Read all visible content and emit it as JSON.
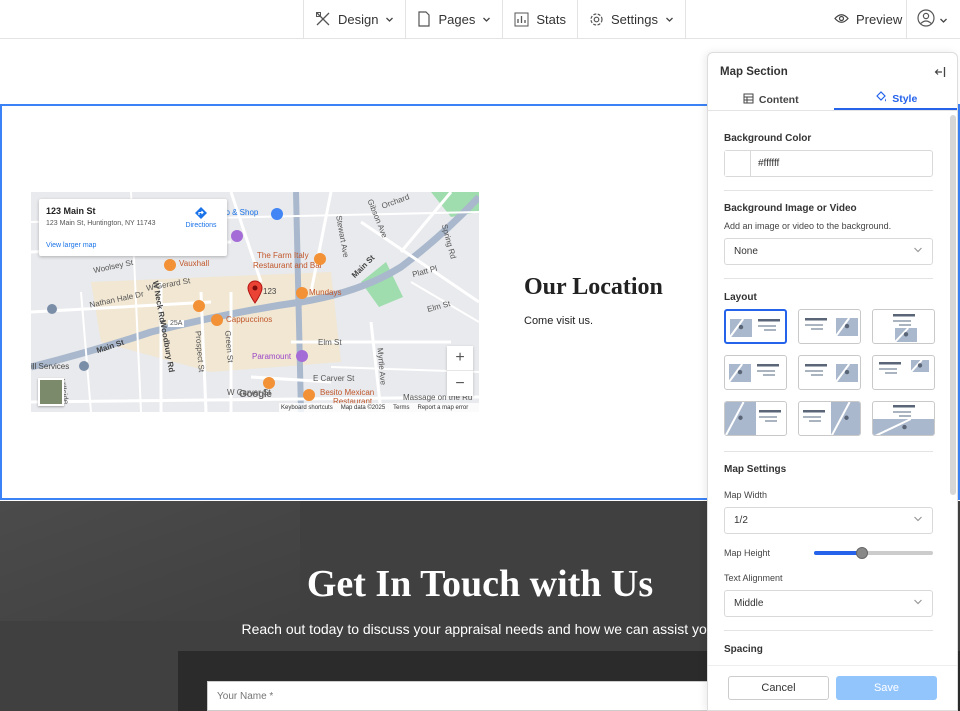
{
  "topbar": {
    "nav": [
      {
        "label": "Design",
        "icon": "brush-ruler-icon"
      },
      {
        "label": "Pages",
        "icon": "page-icon"
      },
      {
        "label": "Stats",
        "icon": "bar-chart-icon"
      },
      {
        "label": "Settings",
        "icon": "gear-icon"
      }
    ],
    "preview": "Preview"
  },
  "map": {
    "card_title": "123 Main St",
    "card_address": "123 Main St, Huntington, NY 11743",
    "directions": "Directions",
    "larger_map": "View larger map",
    "zoom_in": "+",
    "zoom_out": "−",
    "google": "Google",
    "attribution": [
      "Keyboard shortcuts",
      "Map data ©2025",
      "Terms",
      "Report a map error"
    ],
    "labels": {
      "woolsey": "Woolsey St",
      "nathan": "Nathan Hale Dr",
      "gerard": "W Gerard St",
      "mainw": "Main St",
      "vauxhall": "Vauxhall",
      "farm": "The Farm Italy",
      "farm2": "Restaurant and Bar",
      "mundays": "Mundays",
      "capp": "Cappuccinos",
      "paramount": "Paramount",
      "besito": "Besito Mexican",
      "besito2": "Restaurant",
      "pin": "123",
      "shop": "op & Shop",
      "stewart": "Stewart Ave",
      "gibson": "Gibson Ave",
      "orchard": "Orchard",
      "spring": "Spring Rd",
      "platt": "Platt Pl",
      "elm": "Elm St",
      "elm2": "Elm St",
      "mainE": "Main St",
      "woodbury": "Woodbury Rd",
      "prospect": "Prospect St",
      "green": "Green St",
      "neck": "W Neck Rd",
      "carver": "E Carver St",
      "wcarver": "W Carver St",
      "myrtle": "Myrtle Ave",
      "massage": "Massage on the Ru",
      "services": "ill Services",
      "hillside": "Hillside",
      "route": "25A"
    }
  },
  "location": {
    "title": "Our Location",
    "subtitle": "Come visit us."
  },
  "contact": {
    "title": "Get In Touch with Us",
    "subtitle": "Reach out today to discuss your appraisal needs and how we can assist you.",
    "name_placeholder": "Your Name *"
  },
  "panel": {
    "title": "Map Section",
    "tabs": [
      {
        "label": "Content",
        "active": false
      },
      {
        "label": "Style",
        "active": true
      }
    ],
    "background_color_label": "Background Color",
    "background_color": "#ffffff",
    "bg_media_label": "Background Image or Video",
    "bg_media_help": "Add an image or video to the background.",
    "bg_media_value": "None",
    "layout_label": "Layout",
    "selected_layout": 1,
    "map_settings_label": "Map Settings",
    "map_width_label": "Map Width",
    "map_width_value": "1/2",
    "map_height_label": "Map Height",
    "map_height_level": 0.4,
    "text_alignment_label": "Text Alignment",
    "text_alignment_value": "Middle",
    "spacing_label": "Spacing",
    "cancel": "Cancel",
    "save": "Save"
  },
  "colors": {
    "accent": "#2563eb",
    "save_disabled": "#93c5fd",
    "dark_section": "#404040"
  }
}
